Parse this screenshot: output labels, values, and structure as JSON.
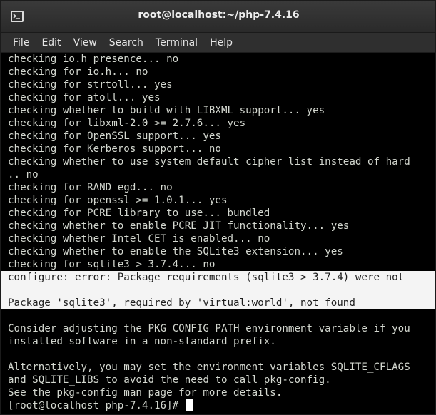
{
  "window": {
    "title": "root@localhost:~/php-7.4.16"
  },
  "menu": {
    "items": [
      "File",
      "Edit",
      "View",
      "Search",
      "Terminal",
      "Help"
    ]
  },
  "terminal": {
    "lines": [
      {
        "text": "checking io.h presence... no",
        "highlight": false
      },
      {
        "text": "checking for io.h... no",
        "highlight": false
      },
      {
        "text": "checking for strtoll... yes",
        "highlight": false
      },
      {
        "text": "checking for atoll... yes",
        "highlight": false
      },
      {
        "text": "checking whether to build with LIBXML support... yes",
        "highlight": false
      },
      {
        "text": "checking for libxml-2.0 >= 2.7.6... yes",
        "highlight": false
      },
      {
        "text": "checking for OpenSSL support... yes",
        "highlight": false
      },
      {
        "text": "checking for Kerberos support... no",
        "highlight": false
      },
      {
        "text": "checking whether to use system default cipher list instead of hard",
        "highlight": false
      },
      {
        "text": ".. no",
        "highlight": false
      },
      {
        "text": "checking for RAND_egd... no",
        "highlight": false
      },
      {
        "text": "checking for openssl >= 1.0.1... yes",
        "highlight": false
      },
      {
        "text": "checking for PCRE library to use... bundled",
        "highlight": false
      },
      {
        "text": "checking whether to enable PCRE JIT functionality... yes",
        "highlight": false
      },
      {
        "text": "checking whether Intel CET is enabled... no",
        "highlight": false
      },
      {
        "text": "checking whether to enable the SQLite3 extension... yes",
        "highlight": false
      },
      {
        "text": "checking for sqlite3 > 3.7.4... no",
        "highlight": false
      },
      {
        "text": "configure: error: Package requirements (sqlite3 > 3.7.4) were not",
        "highlight": true
      },
      {
        "text": "",
        "highlight": true
      },
      {
        "text": "Package 'sqlite3', required by 'virtual:world', not found",
        "highlight": true
      },
      {
        "text": "",
        "highlight": false
      },
      {
        "text": "Consider adjusting the PKG_CONFIG_PATH environment variable if you",
        "highlight": false
      },
      {
        "text": "installed software in a non-standard prefix.",
        "highlight": false
      },
      {
        "text": "",
        "highlight": false
      },
      {
        "text": "Alternatively, you may set the environment variables SQLITE_CFLAGS",
        "highlight": false
      },
      {
        "text": "and SQLITE_LIBS to avoid the need to call pkg-config.",
        "highlight": false
      },
      {
        "text": "See the pkg-config man page for more details.",
        "highlight": false
      }
    ],
    "prompt": "[root@localhost php-7.4.16]# "
  },
  "icons": {
    "app": "terminal-icon"
  },
  "colors": {
    "background": "#000000",
    "foreground": "#d3d7cf",
    "highlight_bg": "#f4f4f4",
    "highlight_fg": "#1e1e1e"
  }
}
